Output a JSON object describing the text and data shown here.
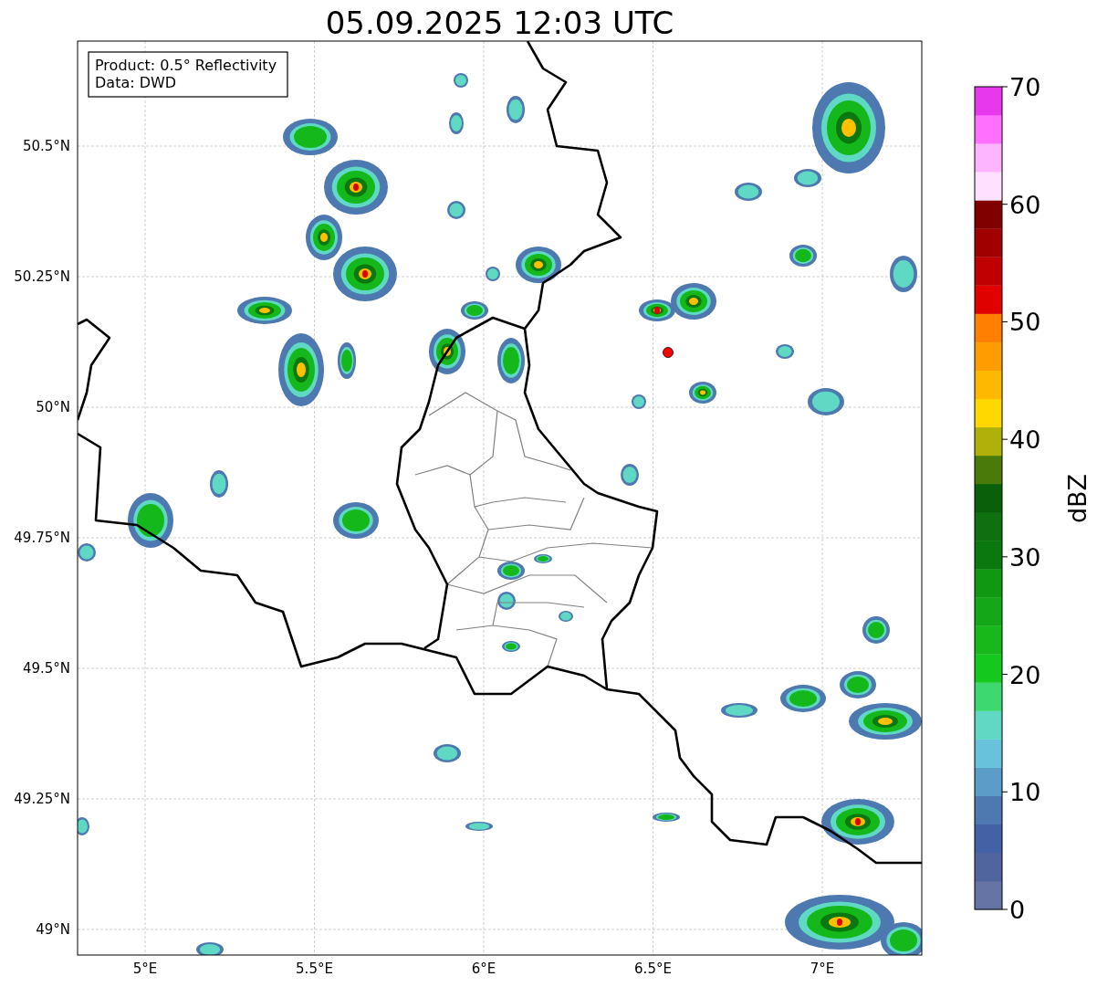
{
  "title": "05.09.2025 12:03 UTC",
  "legend": {
    "lines": [
      "Product: 0.5° Reflectivity",
      "Data: DWD"
    ]
  },
  "y_ticks": [
    "50.5°N",
    "50.25°N",
    "50°N",
    "49.75°N",
    "49.5°N",
    "49.25°N",
    "49°N"
  ],
  "x_ticks": [
    "5°E",
    "5.5°E",
    "6°E",
    "6.5°E",
    "7°E"
  ],
  "colorbar": {
    "label": "dBZ",
    "ticks": [
      "70",
      "60",
      "50",
      "40",
      "30",
      "20",
      "10",
      "0"
    ],
    "bins": [
      {
        "color": "#6673a5"
      },
      {
        "color": "#50649e"
      },
      {
        "color": "#4561a6"
      },
      {
        "color": "#4d78b0"
      },
      {
        "color": "#5b9cc8"
      },
      {
        "color": "#68c2dc"
      },
      {
        "color": "#5fd8c4"
      },
      {
        "color": "#3ed870"
      },
      {
        "color": "#14c81e"
      },
      {
        "color": "#16b81a"
      },
      {
        "color": "#14a818"
      },
      {
        "color": "#109812"
      },
      {
        "color": "#0a780e"
      },
      {
        "color": "#0e700e"
      },
      {
        "color": "#0a600a"
      },
      {
        "color": "#4a7a0a"
      },
      {
        "color": "#b0b00a"
      },
      {
        "color": "#ffd800"
      },
      {
        "color": "#ffb800"
      },
      {
        "color": "#ff9c00"
      },
      {
        "color": "#ff8000"
      },
      {
        "color": "#e00000"
      },
      {
        "color": "#c00000"
      },
      {
        "color": "#a00000"
      },
      {
        "color": "#800000"
      },
      {
        "color": "#ffe0ff"
      },
      {
        "color": "#ffb4ff"
      },
      {
        "color": "#ff70ff"
      },
      {
        "color": "#e838ee"
      }
    ]
  }
}
